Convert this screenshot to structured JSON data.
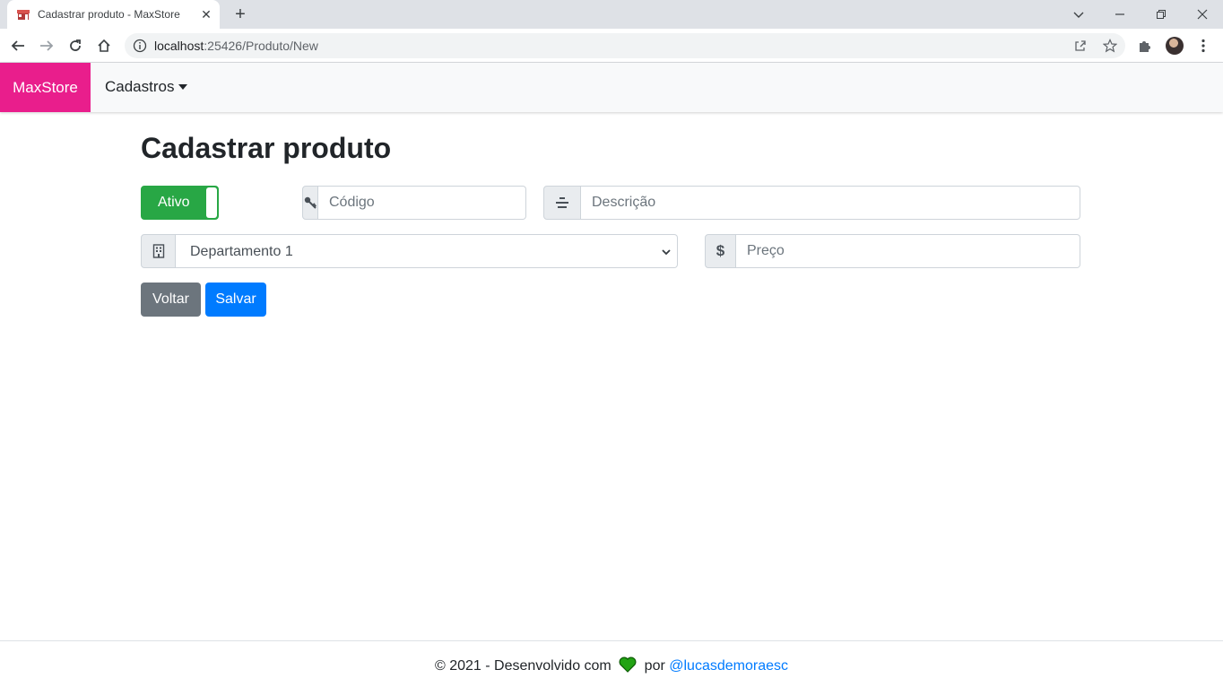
{
  "browser": {
    "tab_title": "Cadastrar produto - MaxStore",
    "url_host": "localhost",
    "url_path": ":25426/Produto/New"
  },
  "navbar": {
    "brand": "MaxStore",
    "brand_color": "#e91e8c",
    "menu_label": "Cadastros"
  },
  "form": {
    "title": "Cadastrar produto",
    "active_toggle_label": "Ativo",
    "active": true,
    "code_placeholder": "Código",
    "description_placeholder": "Descrição",
    "department_selected": "Departamento 1",
    "price_placeholder": "Preço",
    "price_addon": "$",
    "back_button": "Voltar",
    "save_button": "Salvar"
  },
  "footer": {
    "prefix": "© 2021 - Desenvolvido com",
    "by": "por",
    "author_link": "@lucasdemoraesc",
    "heart_color": "#22a314"
  },
  "icons": [
    "key-icon",
    "align-center-icon",
    "building-icon",
    "dollar-icon",
    "heart-icon"
  ]
}
